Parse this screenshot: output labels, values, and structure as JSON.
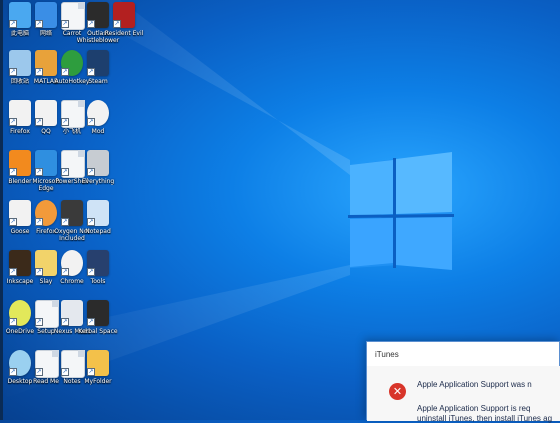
{
  "desktop": {
    "wallpaper": "Windows 10 default",
    "accent": "#0d7fe6",
    "icons": [
      {
        "label": "此电脑",
        "color": "#4aa8f0",
        "kind": "square"
      },
      {
        "label": "网络",
        "color": "#3a8ee6",
        "kind": "square"
      },
      {
        "label": "Carrot",
        "color": "#f4f6f8",
        "kind": "doc"
      },
      {
        "label": "Outlast Whistleblower",
        "color": "#2b2b2b",
        "kind": "square"
      },
      {
        "label": "Resident Evil",
        "color": "#b32020",
        "kind": "square"
      },
      {
        "label": "回收站",
        "color": "#9cc8ec",
        "kind": "square"
      },
      {
        "label": "MATLAB",
        "color": "#e8a23a",
        "kind": "square"
      },
      {
        "label": "AutoHotkey",
        "color": "#2e9d3e",
        "kind": "round"
      },
      {
        "label": "Steam",
        "color": "#1d3f6e",
        "kind": "square"
      },
      {
        "label": "Firefox",
        "color": "#f2f2f2",
        "kind": "square"
      },
      {
        "label": "QQ",
        "color": "#f2f2f2",
        "kind": "square"
      },
      {
        "label": "小飞机",
        "color": "#f4f6f8",
        "kind": "doc"
      },
      {
        "label": "Mod",
        "color": "#f2f2f2",
        "kind": "round"
      },
      {
        "label": "Blender",
        "color": "#f28a1e",
        "kind": "square"
      },
      {
        "label": "Microsoft Edge",
        "color": "#2f8fe0",
        "kind": "square"
      },
      {
        "label": "PowerShell",
        "color": "#f4f6f8",
        "kind": "doc"
      },
      {
        "label": "Everything",
        "color": "#c7ccd2",
        "kind": "square"
      },
      {
        "label": "Goose",
        "color": "#f2f2f2",
        "kind": "square"
      },
      {
        "label": "Firefox",
        "color": "#f29a3a",
        "kind": "round"
      },
      {
        "label": "Oxygen Not Included",
        "color": "#3a3a3a",
        "kind": "square"
      },
      {
        "label": "Notepad",
        "color": "#cfe3f6",
        "kind": "square"
      },
      {
        "label": "Inkscape",
        "color": "#3b2a1a",
        "kind": "square"
      },
      {
        "label": "Slay",
        "color": "#f2d36a",
        "kind": "square"
      },
      {
        "label": "Chrome",
        "color": "#f2f2f2",
        "kind": "round"
      },
      {
        "label": "Tools",
        "color": "#27406e",
        "kind": "square"
      },
      {
        "label": "OneDrive",
        "color": "#e2e85a",
        "kind": "round"
      },
      {
        "label": "Setup",
        "color": "#f4f6f8",
        "kind": "doc"
      },
      {
        "label": "Nexus Mods",
        "color": "#e4e8ee",
        "kind": "square"
      },
      {
        "label": "Kerbal Space",
        "color": "#2b2b2b",
        "kind": "square"
      },
      {
        "label": "Desktop",
        "color": "#9ad0f0",
        "kind": "round"
      },
      {
        "label": "Read Me",
        "color": "#f4f6f8",
        "kind": "doc"
      },
      {
        "label": "Notes",
        "color": "#f4f6f8",
        "kind": "doc"
      },
      {
        "label": "MyFolder",
        "color": "#f3c14a",
        "kind": "square"
      }
    ]
  },
  "dialog": {
    "title": "iTunes",
    "icon": "error-icon",
    "line1": "Apple Application Support was n",
    "line2": "Apple Application Support is req",
    "line3": "uninstall iTunes, then install iTunes ag"
  }
}
